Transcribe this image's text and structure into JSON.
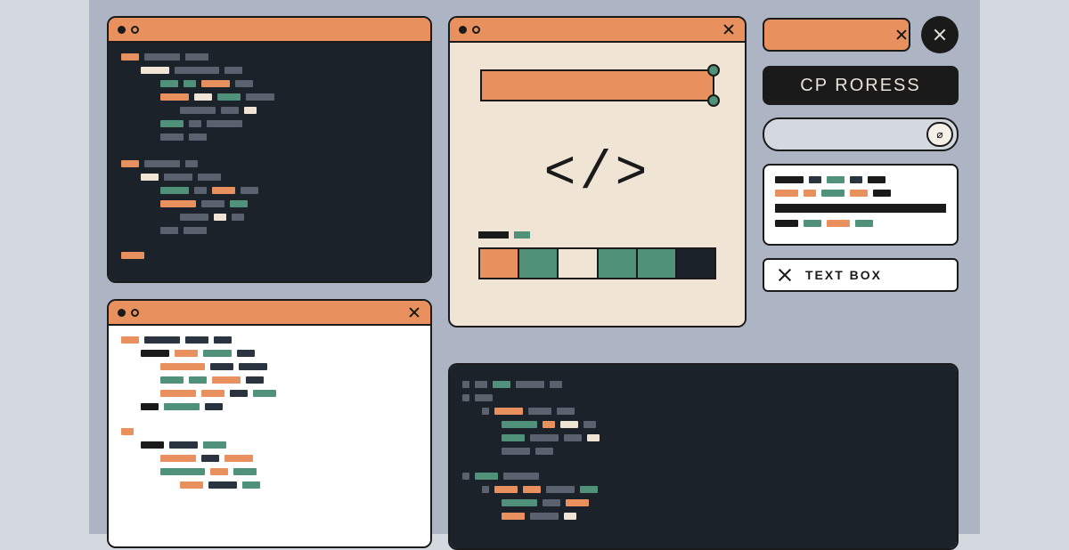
{
  "sidebar": {
    "label_button": "CP RORESS",
    "textbox_label": "TEXT BOX",
    "search_glyph": "⌀"
  },
  "mid": {
    "code_glyph": "</>",
    "palette": [
      "#e8915f",
      "#4f9179",
      "#f0e4d4",
      "#4f9179",
      "#4f9179",
      "#1c222a"
    ]
  },
  "colors": {
    "accent": "#e8915f",
    "green": "#4f9179",
    "cream": "#f0e4d4",
    "dark": "#1c222a",
    "ink": "#1a1a1a"
  }
}
